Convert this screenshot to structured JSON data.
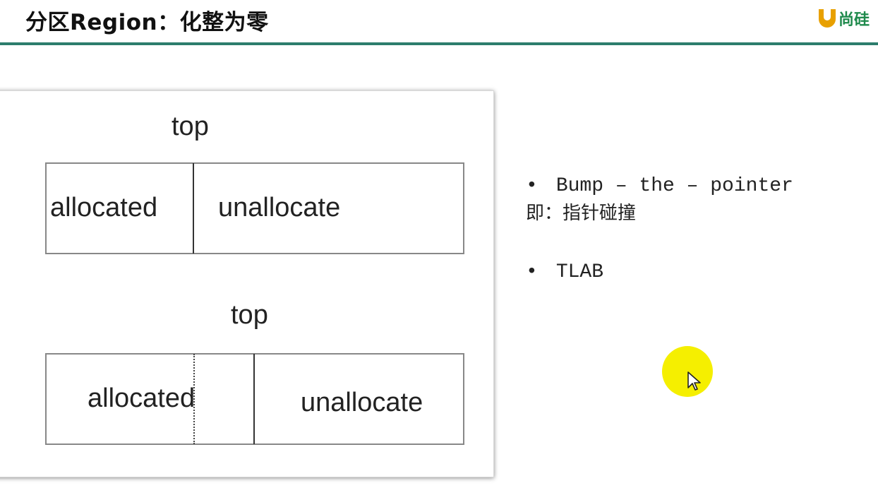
{
  "header": {
    "title": "分区Region：化整为零",
    "logo_text": "尚硅"
  },
  "diagram": {
    "top1": {
      "label": "top",
      "allocated": "allocated",
      "unallocate": "unallocate"
    },
    "top2": {
      "label": "top",
      "allocated": "allocated",
      "unallocate": "unallocate"
    }
  },
  "notes": {
    "bullet1": "Bump – the – pointer",
    "bullet1_sub": "即：指针碰撞",
    "bullet2": "TLAB",
    "bullet_symbol": "•"
  },
  "colors": {
    "rule": "#2d7d6d",
    "logo_green": "#1f8a4c",
    "logo_orange": "#e8a000",
    "cursor_highlight": "#f5ef00"
  }
}
